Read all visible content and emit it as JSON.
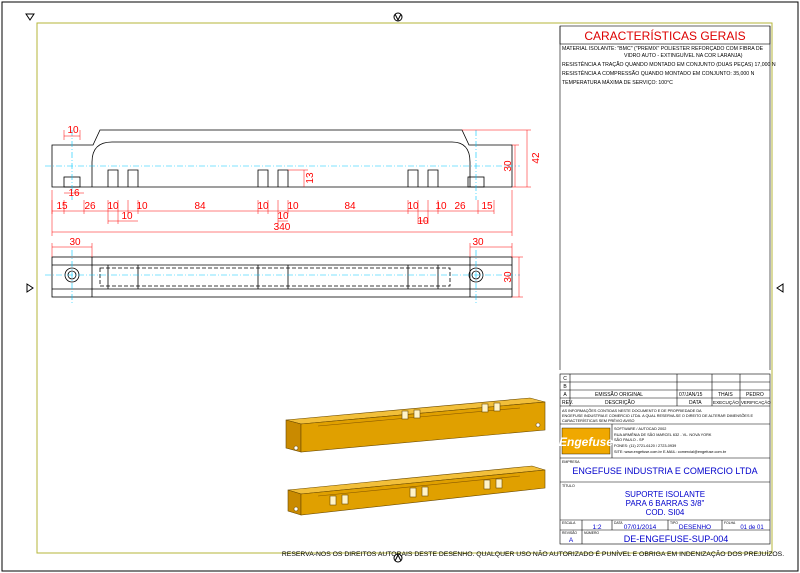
{
  "specs": {
    "title": "CARACTERÍSTICAS GERAIS",
    "material_l1": "MATERIAL ISOLANTE: \"BMC\" (\"PREMIX\" POLIESTER REFORÇADO COM FIBRA DE",
    "material_l2": "VIDRO AUTO - EXTINGUÍVEL NA COR LARANJA)",
    "tensile": "RESISTÊNCIA A TRAÇÃO QUANDO MONTADO EM CONJUNTO (DUAS PEÇAS) 17,000 N",
    "compression": "RESISTÊNCIA A COMPRESSÃO QUANDO MONTADO EM CONJUNTO: 35,000 N",
    "temperature": "TEMPERATURA MÁXIMA DE SERVIÇO: 100°C"
  },
  "dims": {
    "d10": "10",
    "d16": "16",
    "d15": "15",
    "d26": "26",
    "d84": "84",
    "d340": "340",
    "d30": "30",
    "d42": "42",
    "d13": "13"
  },
  "title_block": {
    "rev_c": "C",
    "rev_b": "B",
    "rev_a": "A",
    "emission": "EMISSÃO ORIGINAL",
    "date_val": "07/JAN/15",
    "exec_val": "THAIS",
    "verif_val": "PEDRO",
    "hdr_rev": "REV.",
    "hdr_desc": "DESCRIÇÃO",
    "hdr_date": "DATA",
    "hdr_exec": "EXECUÇÃO",
    "hdr_verif": "VERIFICAÇÃO",
    "notice_l1": "AS INFORMAÇÕES CONTIDAS NESTE DOCUMENTO E DE PROPRIEDADE DA",
    "notice_l2": "ENGEFUSE INDUSTRIA E COMERCIO LTDA. A QUAL RESERVA-SE O DIREITO DE ALTERAR DIMENSÕES E",
    "notice_l3": "CARACTERÍSTICAS SEM PRÉVIO AVISO",
    "logo_text": "Engefuse",
    "software": "SOFTWARE / AUTOCAD 2002",
    "address_l1": "RUA ARMÊNIA DE SÃO MARCEL 632 - VL. NOVA YORK",
    "address_l2": "SÃO PAULO - SP",
    "phone": "FONES: (11) 2721-6120 / 2723-0939",
    "site": "SITE: www.engefuse.com.br  E-MAIL: comercial@engefuse.com.br",
    "lbl_company": "EMPRESA",
    "company": "ENGEFUSE INDUSTRIA E COMERCIO LTDA",
    "lbl_title": "TÍTULO",
    "title_l1": "SUPORTE ISOLANTE",
    "title_l2": "PARA 6 BARRAS 3/8\"",
    "title_l3": "COD. SI04",
    "lbl_scale": "ESCALA",
    "scale": "1:2",
    "lbl_date": "DATA",
    "date": "07/01/2014",
    "lbl_type": "TIPO",
    "type": "DESENHO",
    "lbl_sheet": "FOLHA",
    "sheet_of": "01  de  01",
    "lbl_rev": "REVISÃO",
    "rev": "A",
    "lbl_number": "NÚMERO",
    "drawing_no": "DE-ENGEFUSE-SUP-004"
  },
  "footer": "RESERVA-NOS OS DIREITOS AUTORAIS DESTE DESENHO. QUALQUER USO NÃO AUTORIZADO É PUNÍVEL E OBRIGA EM INDENIZAÇÃO DOS PREJUÍZOS.",
  "colors": {
    "border": "#000000",
    "frame": "#b5b53a",
    "dimension": "#ff0000",
    "centerline": "#00c8ff",
    "body_orange": "#e0a000",
    "title_blue": "#0000cc",
    "red_text": "#dd0000"
  }
}
